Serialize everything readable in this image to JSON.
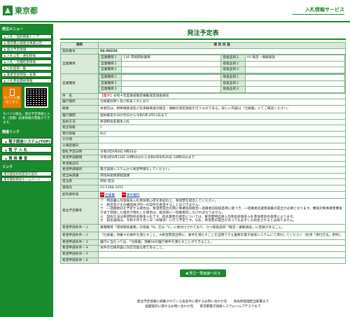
{
  "header": {
    "logo_text": "東京都",
    "system_title": "入札情報サービス"
  },
  "sidebar": {
    "section_menu": "発注メニュー",
    "items": [
      "入札・契約情報トップ",
      "東京都公報発注事業公告",
      "発注予定情報",
      "入札公告・通知情報",
      "入札・見積結果情報",
      "入札結果一覧",
      "業者登録情報・名簿",
      "入札参加資格情報"
    ],
    "mobile_label": "モバイル版 はこちら",
    "mobile_desc": "モバイル版は、発注予定情報と入札（見積）結果情報の閲覧ができます。",
    "section_links": "関連リンク",
    "big_buttons": [
      "電子調達システム(TOP)",
      "電 子 入 札",
      "資 格 審 査"
    ],
    "section_links2": "リンク",
    "links": [
      "東京都契約制度等の案内",
      "東京都財務局ホームページ"
    ]
  },
  "main": {
    "title": "発注予定表",
    "head_item": "項目",
    "head_content": "項 目 内 容",
    "rows": [
      {
        "label": "契約番号",
        "value": "04-00226"
      },
      {
        "label": "件　名",
        "value_prefix": "【電子】",
        "value": "令和４年度鉄道騒音振動測定調査委託"
      },
      {
        "label": "履行場所",
        "value": "仕様書別添１及び別表２のとおり"
      },
      {
        "label": "概要",
        "value": "本委託は、新幹線鉄道及び在来線鉄道の騒音・振動の測定調査を行うものである。詳しい内容は「仕様書」にてご確認ください。"
      },
      {
        "label": "履行期間",
        "value": "契約確定の日の翌日から令和5年3月10日まで"
      },
      {
        "label": "契約方法",
        "value": "希望制指名競争入札"
      },
      {
        "label": "発注等級",
        "value": "C"
      },
      {
        "label": "受付等級",
        "value": "BLC"
      },
      {
        "label": "その他",
        "value": ""
      },
      {
        "label": "公報登載日",
        "value": ""
      },
      {
        "label": "開札予定日時",
        "value": "令和4年9月8日 9時30分"
      },
      {
        "label": "希望申請期間",
        "value": "令和4年8月23日 10時00分から令和4年8月26日 16時00分まで"
      },
      {
        "label": "希望確認日",
        "value": ""
      },
      {
        "label": "希望申請場所",
        "value": "電子調達システムから希望申請をしてください。"
      },
      {
        "label": "担当局部課",
        "value": "環境局総務部経理課"
      },
      {
        "label": "担当者",
        "value": "岡坂 担当"
      },
      {
        "label": "連絡先",
        "value": "03-5388-3451"
      },
      {
        "label": "配布資料等",
        "doc1": "仕様書",
        "doc2": "添付資料"
      },
      {
        "label": "希望申請条件－１",
        "value": "業種種目「環境関係業務」の等級「B」又は「C」に格付けされており、かつ取扱品目「騒音・振動調査」に登録があること。"
      },
      {
        "label": "希望申請条件－２",
        "value": "「仕様書」項番４の要件を満たすこと。※希望票提出時に、要件を満たすことを証明できる書類を電子調達システムにて添付してください（別添「添付方法」参照）。"
      },
      {
        "label": "希望申請条件－３",
        "value": "履行に当たっては、「仕様書」項番16の履行要件を満たすことができること。"
      },
      {
        "label": "希望申請条件－４",
        "value": "本件の仕様内容に対応可能な者であること。"
      },
      {
        "label": "希望申請条件－５",
        "value": ""
      },
      {
        "label": "希望申請条件－６",
        "value": ""
      }
    ],
    "business_label": "営業種目",
    "business_rows": [
      {
        "k1": "営業種目１",
        "v1": "126 環境関係業務",
        "k2": "取扱品目１",
        "v2": "05 騒音・振動調査"
      },
      {
        "k1": "営業種目２",
        "v1": "",
        "k2": "取扱品目２",
        "v2": ""
      },
      {
        "k1": "営業種目３",
        "v1": "",
        "k2": "取扱品目３",
        "v2": ""
      }
    ],
    "business2_label": "営業種目",
    "business2_rows": [
      {
        "k1": "営業種目１",
        "v1": "",
        "k2": "取扱品目１",
        "v2": ""
      },
      {
        "k1": "営業種目２",
        "v1": "",
        "k2": "取扱品目２",
        "v2": ""
      },
      {
        "k1": "営業種目３",
        "v1": "",
        "k2": "取扱品目３",
        "v2": ""
      }
    ],
    "remarks_label": "発注予定備考",
    "remarks": [
      "ア　物品購入均等競争入札参加者心得を承認の上、希望票を提出してください。",
      "イ　組合及びその構成員が同一の案件を希望することはできません。",
      "ウ　一括再委託を予定する場合は、希望票提出の際に事業協同組合一括再委託取扱基準に基づき、一括再委託業者調書の提出が必要となります。審査対象事業者審査方式で登録した組合が落札した場合は、組合員に一括再委託しなければなりません。",
      "エ　契約方法は希望制指名競争入札です。指名業者の選定については、東京都物品買入均等指名競争入札参加者指名基準によります。",
      "オ　指名通知は、令和４年９月１日（木曜日）に行う予定です。なお、希望票の提出があっても必ずしも指名されるとは限りません。"
    ],
    "back_button": "発注一覧画面へ戻る"
  },
  "footer": {
    "line1": "発注予定情報に掲載されている各案件に関するお問い合わせ先　　各局所経理担当部署まで",
    "line2": "画面操作に関するお問い合わせ先　　東京都電子調達システムヘルプデスクまで"
  }
}
